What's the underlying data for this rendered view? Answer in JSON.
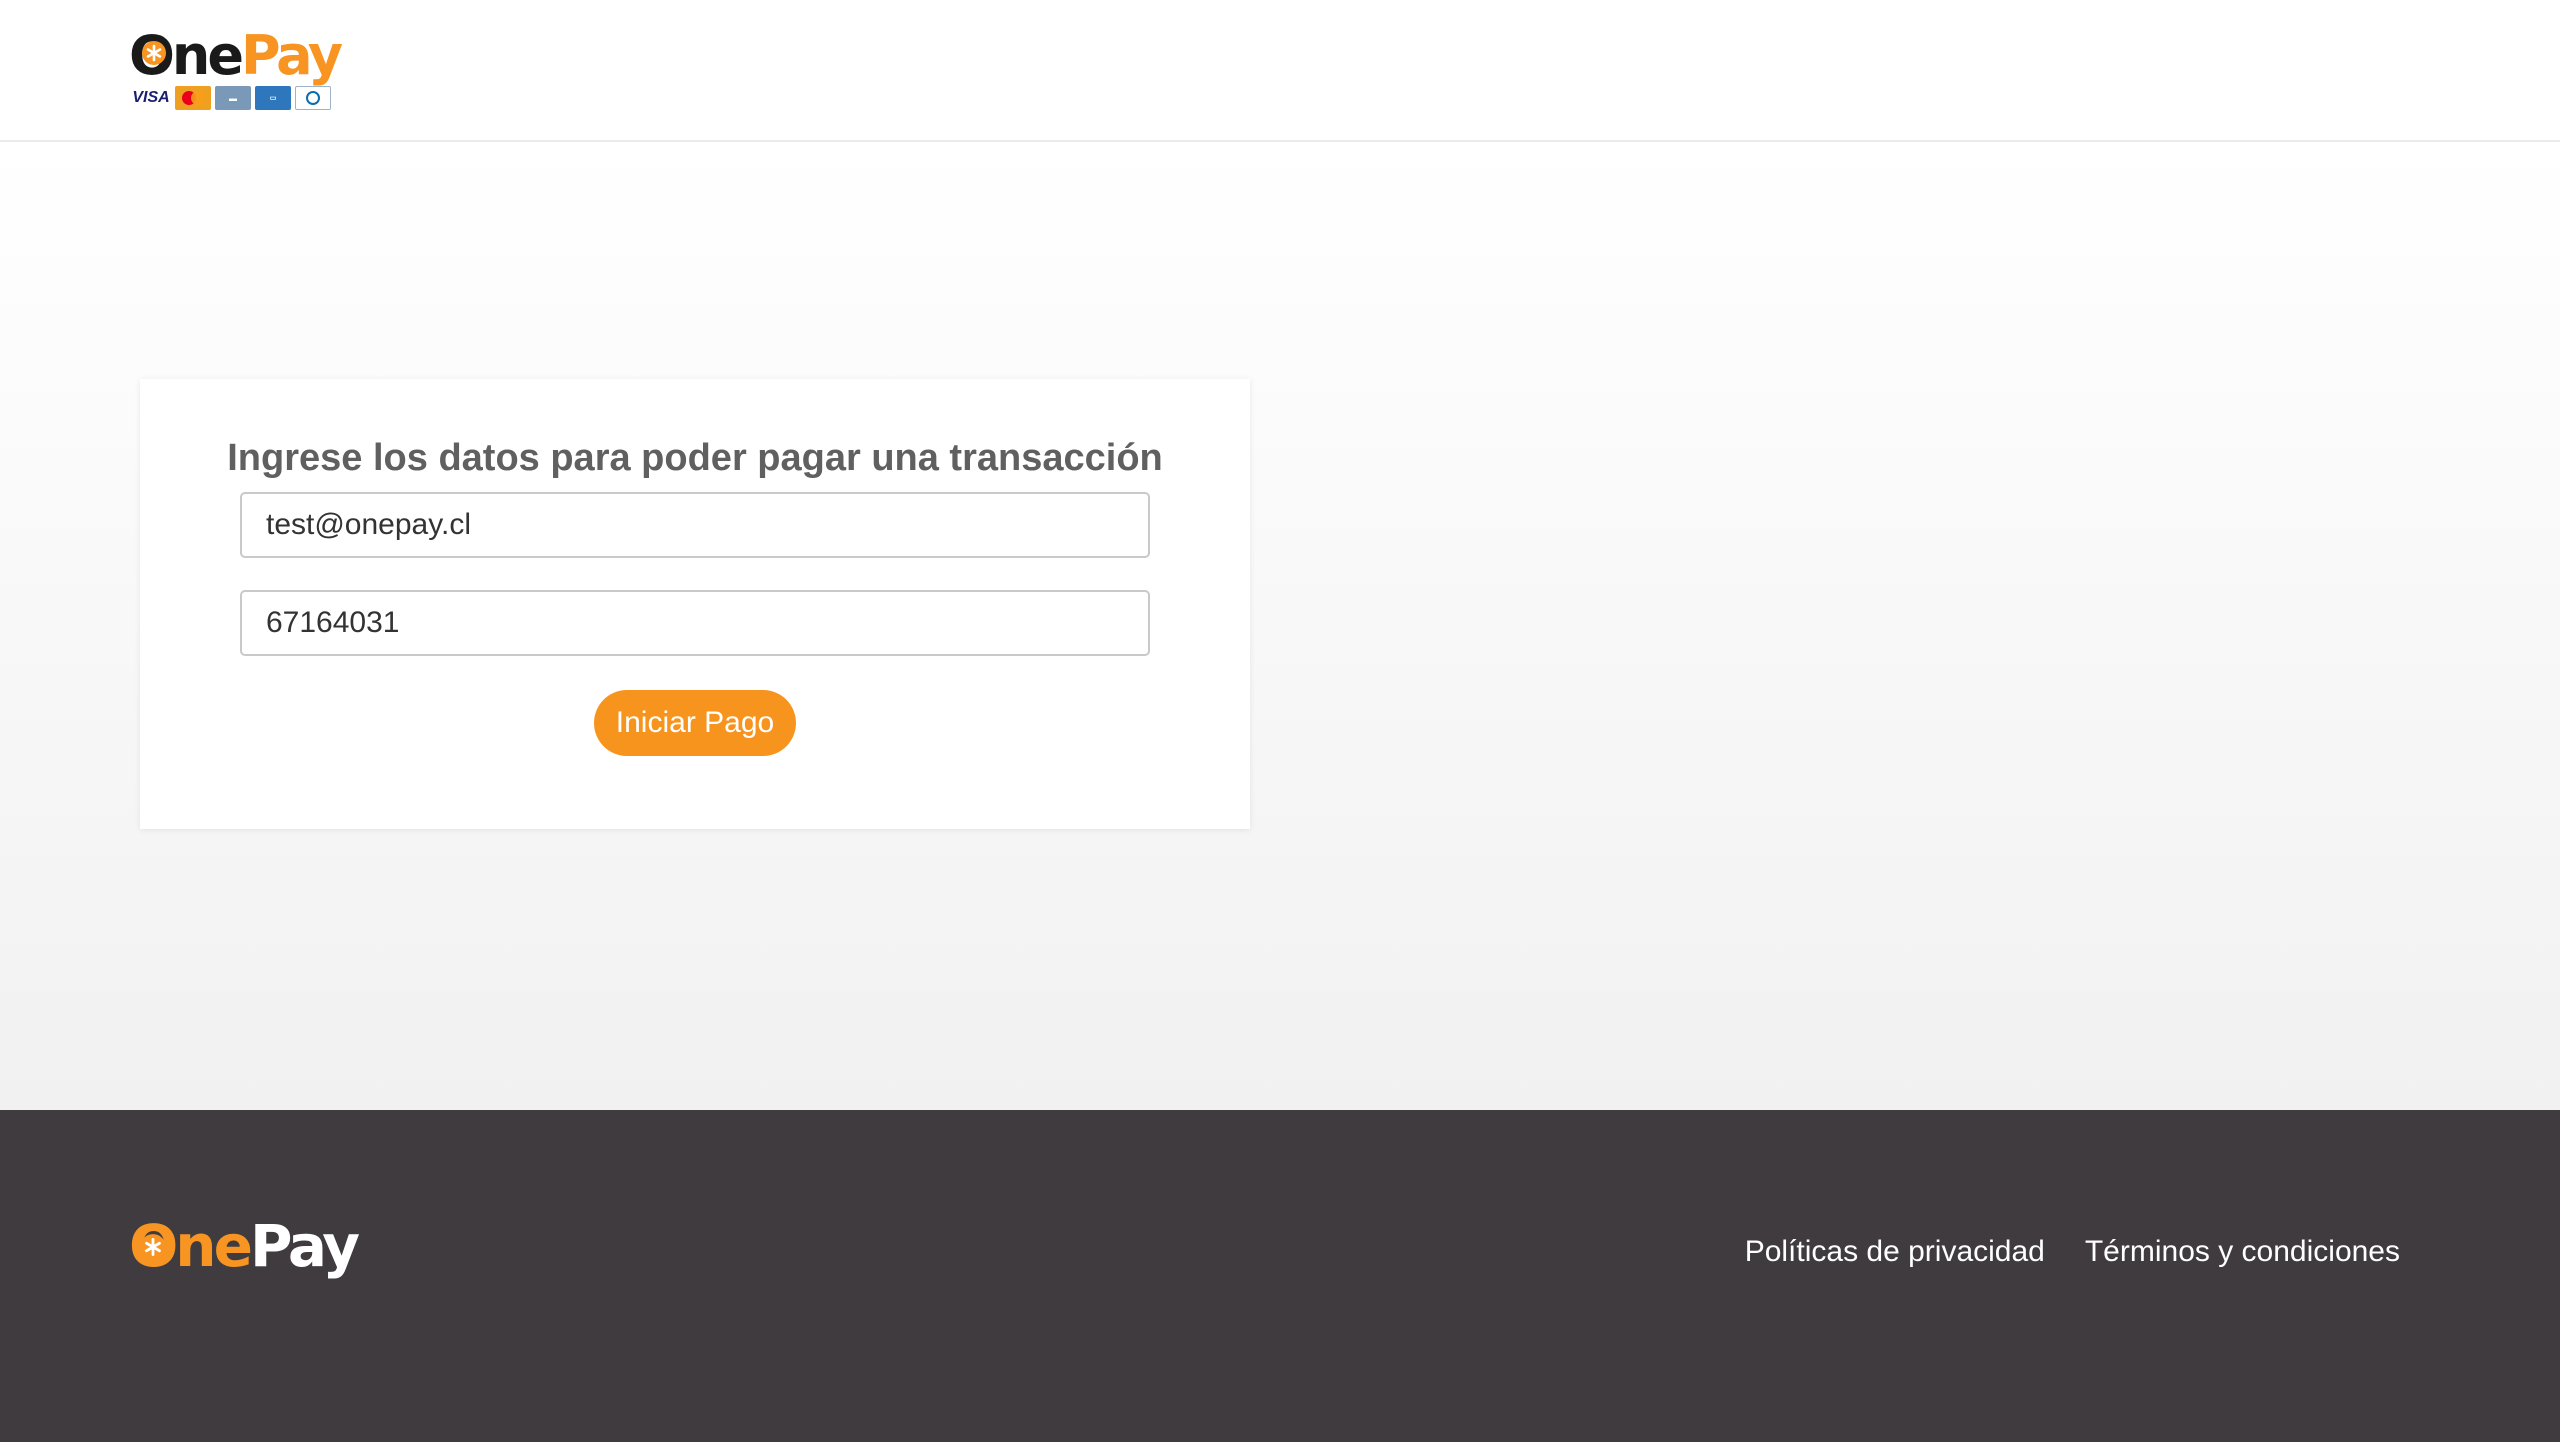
{
  "header": {
    "logo": {
      "text_one": "One",
      "text_pay": "Pay"
    },
    "accepted_cards": [
      "visa",
      "mastercard",
      "magna",
      "american-express",
      "diners-club"
    ]
  },
  "form": {
    "title": "Ingrese los datos para poder pagar una transacción",
    "email_value": "test@onepay.cl",
    "code_value": "67164031",
    "submit_label": "Iniciar Pago"
  },
  "footer": {
    "logo": {
      "text_one": "One",
      "text_pay": "Pay"
    },
    "links": [
      "Políticas de privacidad",
      "Términos y condiciones"
    ]
  },
  "colors": {
    "brand_orange": "#f7941d",
    "footer_background": "#3f3b3f",
    "title_gray": "#606060"
  }
}
